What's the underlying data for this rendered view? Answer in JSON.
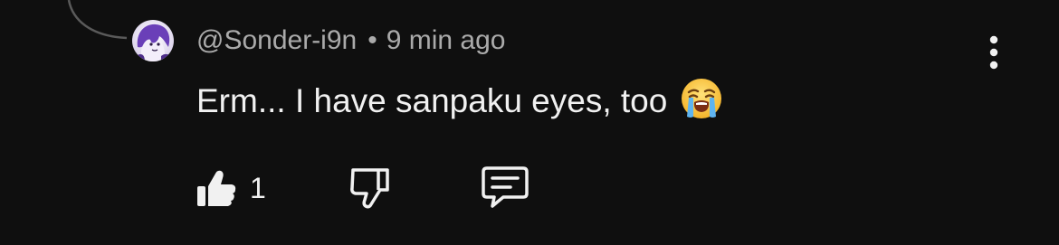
{
  "comment": {
    "handle": "@Sonder-i9n",
    "separator": "•",
    "timestamp": "9 min ago",
    "text": "Erm... I have sanpaku eyes, too",
    "emoji": "loudly-crying-face",
    "more_icon": "vertical-ellipsis-icon"
  },
  "actions": {
    "like_icon": "thumbs-up-icon",
    "like_count": "1",
    "dislike_icon": "thumbs-down-icon",
    "reply_icon": "comment-reply-icon"
  },
  "colors": {
    "background": "#0f0f0f",
    "primary_text": "#f1f1f1",
    "secondary_text": "#aaaaaa",
    "avatar_accent": "#7b4fc9"
  }
}
